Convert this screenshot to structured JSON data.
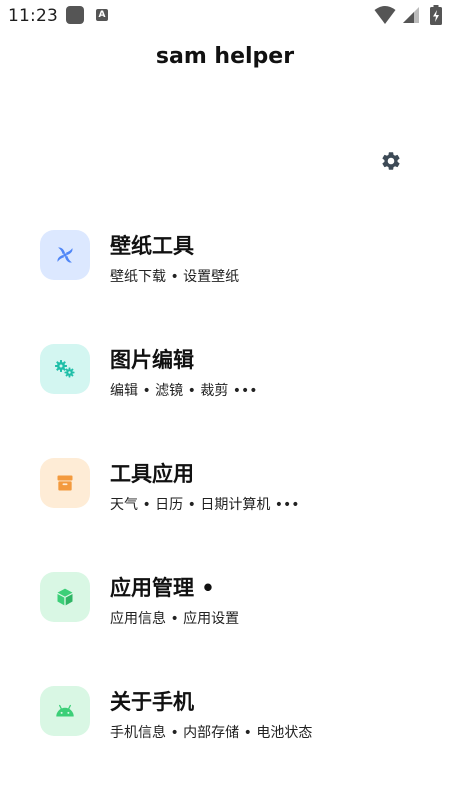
{
  "status_bar": {
    "time": "11:23",
    "app_badge_letter": "A"
  },
  "app": {
    "title": "sam helper"
  },
  "icons": {
    "settings": "gear-icon",
    "wallpaper": "fan-icon",
    "image_edit": "gears-icon",
    "tools": "box-icon",
    "app_manage": "cube-icon",
    "about": "android-icon"
  },
  "colors": {
    "wallpaper_bg": "#dce8ff",
    "wallpaper_fg": "#4f86f7",
    "image_edit_bg": "#d3f6f1",
    "image_edit_fg": "#1fbfa8",
    "tools_bg": "#feecd6",
    "tools_fg": "#f39a3e",
    "app_manage_bg": "#d9f7e4",
    "app_manage_fg": "#3ccf78",
    "about_bg": "#d9f7e4",
    "about_fg": "#3ccf78"
  },
  "menu": {
    "items": [
      {
        "title": "壁纸工具",
        "subtitle": "壁纸下载 • 设置壁纸"
      },
      {
        "title": "图片编辑",
        "subtitle": "编辑 • 滤镜 • 裁剪 •••"
      },
      {
        "title": "工具应用",
        "subtitle": "天气 • 日历 • 日期计算机 •••"
      },
      {
        "title": "应用管理 •",
        "subtitle": "应用信息 • 应用设置"
      },
      {
        "title": "关于手机",
        "subtitle": "手机信息 • 内部存储 • 电池状态"
      }
    ]
  }
}
